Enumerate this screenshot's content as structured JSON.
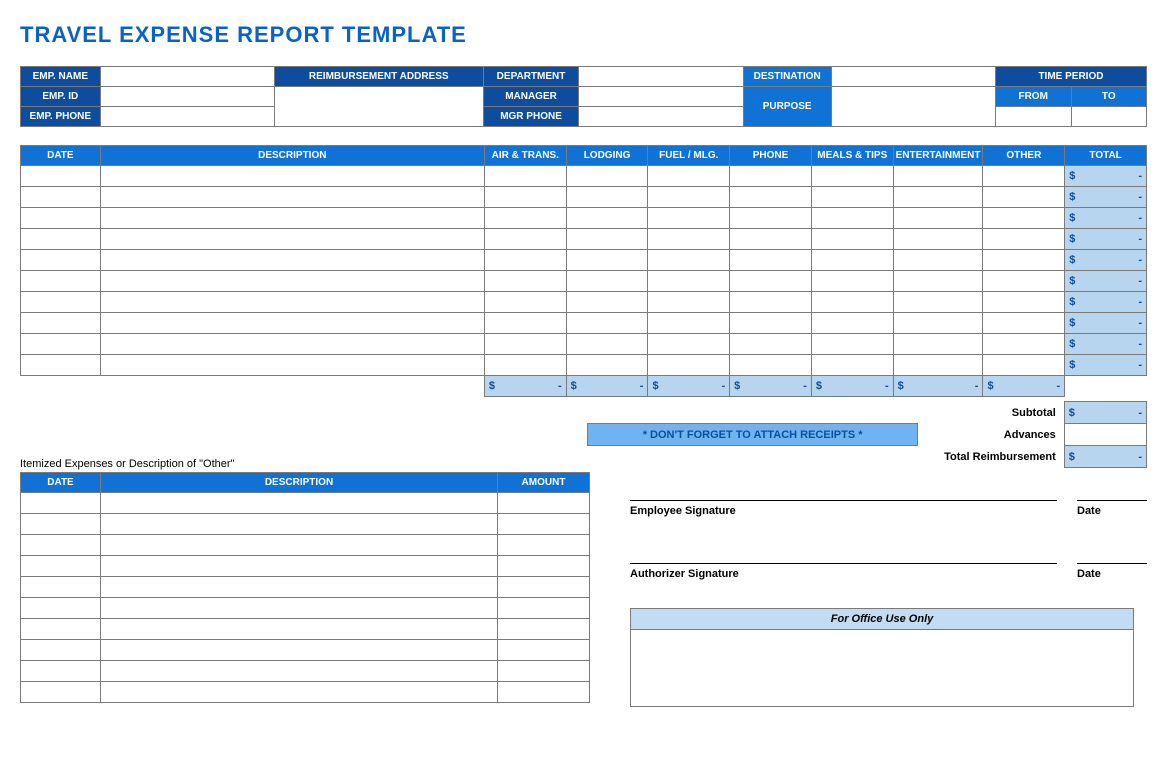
{
  "title": "TRAVEL EXPENSE REPORT TEMPLATE",
  "info": {
    "emp_name_label": "EMP. NAME",
    "emp_id_label": "EMP. ID",
    "emp_phone_label": "EMP. PHONE",
    "reimb_addr_label": "REIMBURSEMENT ADDRESS",
    "department_label": "DEPARTMENT",
    "manager_label": "MANAGER",
    "mgr_phone_label": "MGR PHONE",
    "destination_label": "DESTINATION",
    "purpose_label": "PURPOSE",
    "time_period_label": "TIME PERIOD",
    "from_label": "FROM",
    "to_label": "TO"
  },
  "cols": {
    "date": "DATE",
    "description": "DESCRIPTION",
    "air": "AIR & TRANS.",
    "lodging": "LODGING",
    "fuel": "FUEL / MLG.",
    "phone": "PHONE",
    "meals": "MEALS & TIPS",
    "ent": "ENTERTAINMENT",
    "other": "OTHER",
    "total": "TOTAL"
  },
  "currency": "$",
  "dash": "-",
  "receipts_note": "* DON'T FORGET TO ATTACH RECEIPTS *",
  "summary": {
    "subtotal_label": "Subtotal",
    "advances_label": "Advances",
    "total_reimb_label": "Total Reimbursement"
  },
  "itemized": {
    "title": "Itemized Expenses or Description of \"Other\"",
    "date": "DATE",
    "description": "DESCRIPTION",
    "amount": "AMOUNT"
  },
  "sig": {
    "employee": "Employee Signature",
    "authorizer": "Authorizer Signature",
    "date": "Date"
  },
  "office": "For Office Use Only"
}
